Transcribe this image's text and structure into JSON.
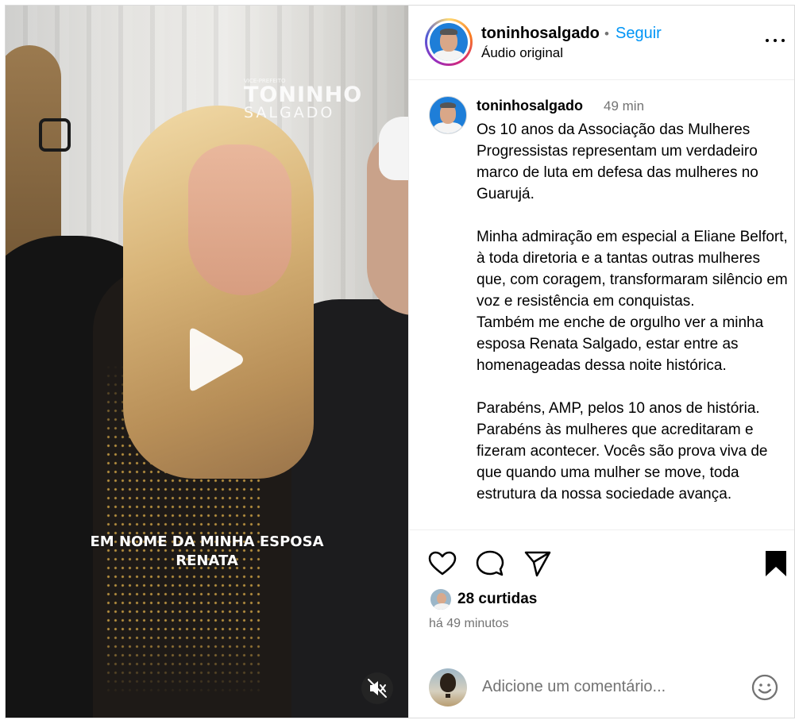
{
  "media": {
    "watermark_small": "VICE-PREFEITO",
    "watermark_line1": "TONINHO",
    "watermark_line2": "SALGADO",
    "caption_line1": "EM NOME DA MINHA ESPOSA",
    "caption_line2": "RENATA",
    "play_icon": "play-icon",
    "mute_icon": "muted-speaker-icon"
  },
  "header": {
    "username": "toninhosalgado",
    "separator": "•",
    "follow_label": "Seguir",
    "audio_label": "Áudio original",
    "more_icon": "more-options-icon"
  },
  "caption": {
    "username": "toninhosalgado",
    "time": "49 min",
    "text": "Os 10 anos da Associação das Mulheres Progressistas representam um verdadeiro marco de luta em defesa das mulheres no Guarujá.\n\nMinha admiração em especial a Eliane Belfort, à toda diretoria e a tantas outras mulheres que, com coragem, transformaram silêncio em voz e resistência em conquistas.\nTambém me enche de orgulho ver a minha esposa Renata Salgado, estar entre as homenageadas dessa noite histórica.\n\nParabéns, AMP, pelos 10 anos de história. Parabéns às mulheres que acreditaram e fizeram acontecer. Vocês são prova viva de que quando uma mulher se move, toda estrutura da nossa sociedade avança."
  },
  "actions": {
    "icons": [
      "heart-icon",
      "comment-icon",
      "share-icon",
      "bookmark-icon"
    ],
    "likes_label": "28 curtidas",
    "time_ago": "há 49 minutos"
  },
  "comment": {
    "placeholder": "Adicione um comentário...",
    "emoji_icon": "emoji-icon"
  },
  "colors": {
    "accent": "#0095f6",
    "muted_text": "#737373",
    "border": "#dbdbdb"
  }
}
